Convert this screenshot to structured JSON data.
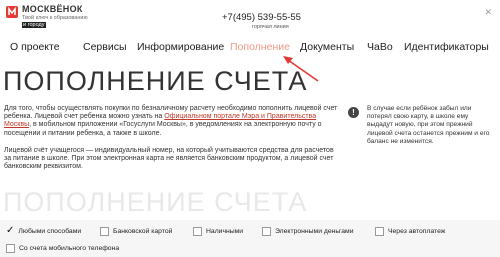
{
  "header": {
    "brand": "МОСКВЁНОК",
    "tagline_line1": "Твой ключ к образованию",
    "tagline_line2": "и городу",
    "phone": "+7(495) 539-55-55",
    "hotline": "горячая линия",
    "close_glyph": "✕"
  },
  "nav": {
    "items": [
      {
        "label": "О проекте"
      },
      {
        "label": "Сервисы"
      },
      {
        "label": "Информирование"
      },
      {
        "label": "Пополнение"
      },
      {
        "label": "Документы"
      },
      {
        "label": "ЧаВо"
      },
      {
        "label": "Идентификаторы"
      }
    ],
    "active_color": "#f19a86"
  },
  "main": {
    "title": "ПОПОЛНЕНИЕ СЧЕТА",
    "intro_part1": "Для того, чтобы осуществлять покупки по безналичному расчету необходимо пополнить лицевой счет ребенка. Лицевой счет ребенка можно узнать на ",
    "intro_link": "Официальном портале Мэра и Правительства Москвы",
    "intro_part2": ", в мобильном приложении «Госуслуги Москвы», в уведомлениях на электронную почту о посещении и питании ребенка, а также в школе.",
    "intro2": "Лицевой счёт учащегося — индивидуальный номер, на который учитываются средства для расчетов за питание в школе. При этом электронная карта не является банковским продуктом, а лицевой счет банковским реквизитом.",
    "note_icon": "!",
    "note": "В случае если ребёнок забыл или потерял свою карту, в школе ему выдадут новую, при этом прежний лицевой счета останется прежним и его баланс не изменится.",
    "bg_heading": "ПОПОЛНЕНИЕ СЧЕТА"
  },
  "payment_tabs": {
    "items": [
      {
        "label": "Любыми способами",
        "selected": true
      },
      {
        "label": "Банковской картой",
        "selected": false
      },
      {
        "label": "Наличными",
        "selected": false
      },
      {
        "label": "Электронными деньгами",
        "selected": false
      },
      {
        "label": "Через автоплатеж",
        "selected": false
      },
      {
        "label": "Со счета мобильного телефона",
        "selected": false
      }
    ],
    "selected_glyph": "✓"
  },
  "colors": {
    "accent": "#f19a86",
    "arrow": "#e53935",
    "link": "#c0392b"
  }
}
